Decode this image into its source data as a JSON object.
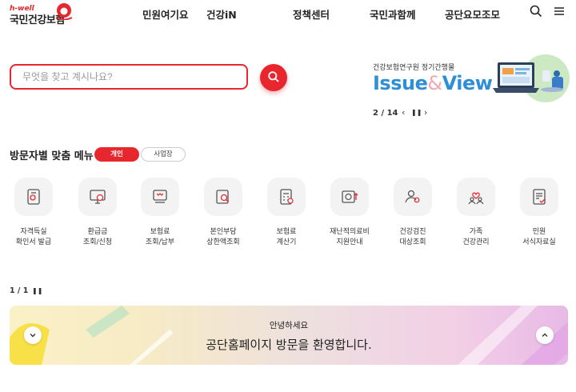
{
  "header": {
    "logo_tagline": "h-well",
    "logo_name": "국민건강보험",
    "nav": [
      "민원여기요",
      "건강iN",
      "정책센터",
      "국민과함께",
      "공단요모조모"
    ],
    "search_icon": "search-icon",
    "menu_icon": "hamburger-icon"
  },
  "search": {
    "placeholder": "무엇을 찾고 계시나요?",
    "button_icon": "search-icon"
  },
  "banner": {
    "subtitle": "건강보험연구원 정기간행물",
    "title_a": "Issue",
    "title_amp": "&",
    "title_b": "View",
    "page": "2 / 14",
    "prev": "‹",
    "pause": "❚❚",
    "next": "›"
  },
  "custom_menu": {
    "title": "방문자별 맞춤 메뉴",
    "tabs": [
      "개인",
      "사업장"
    ],
    "items": [
      {
        "l1": "자격득실",
        "l2": "확인서 발급",
        "icon": "certificate-icon"
      },
      {
        "l1": "환급금",
        "l2": "조회/신청",
        "icon": "monitor-won-icon"
      },
      {
        "l1": "보험료",
        "l2": "조회/납부",
        "icon": "bill-payment-icon"
      },
      {
        "l1": "본인부담",
        "l2": "상한액조회",
        "icon": "document-search-icon"
      },
      {
        "l1": "보험료",
        "l2": "계산기",
        "icon": "calculator-icon"
      },
      {
        "l1": "재난적의료비",
        "l2": "지원안내",
        "icon": "won-support-icon"
      },
      {
        "l1": "건강검진",
        "l2": "대상조회",
        "icon": "people-search-icon"
      },
      {
        "l1": "가족",
        "l2": "건강관리",
        "icon": "family-heart-icon"
      },
      {
        "l1": "민원",
        "l2": "서식자료실",
        "icon": "form-document-icon"
      }
    ]
  },
  "notice": {
    "page": "1 / 1",
    "pause": "❚❚",
    "small": "안녕하세요",
    "large": "공단홈페이지 방문을 환영합니다.",
    "colors": {
      "accent": "#e8262d",
      "title_blue": "#2f8fd6"
    }
  }
}
